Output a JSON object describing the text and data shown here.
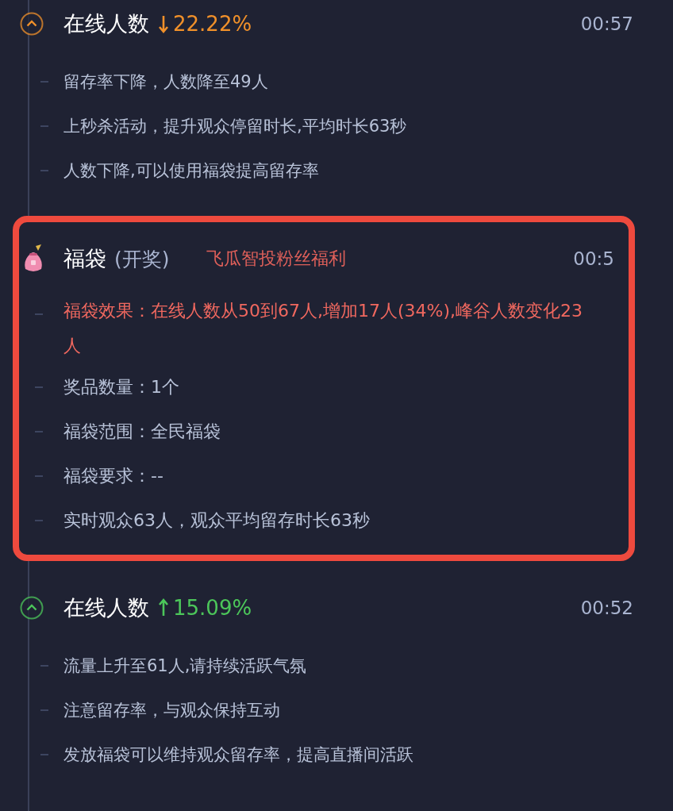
{
  "events": [
    {
      "kind": "online",
      "title": "在线人数",
      "rising": false,
      "change": "22.22%",
      "time": "00:57",
      "highlighted": false,
      "items": [
        {
          "text": "留存率下降，人数降至49人",
          "alert": false
        },
        {
          "text": "上秒杀活动，提升观众停留时长,平均时长63秒",
          "alert": false
        },
        {
          "text": "人数下降,可以使用福袋提高留存率",
          "alert": false
        }
      ]
    },
    {
      "kind": "lucky_bag",
      "title": "福袋",
      "subtitle": "(开奖)",
      "tag": "飞瓜智投粉丝福利",
      "time": "00:5",
      "highlighted": true,
      "items": [
        {
          "text": "福袋效果：在线人数从50到67人,增加17人(34%),峰谷人数变化23人",
          "alert": true
        },
        {
          "text": "奖品数量：1个",
          "alert": false
        },
        {
          "text": "福袋范围：全民福袋",
          "alert": false
        },
        {
          "text": "福袋要求：--",
          "alert": false
        },
        {
          "text": "实时观众63人，观众平均留存时长63秒",
          "alert": false
        }
      ]
    },
    {
      "kind": "online",
      "title": "在线人数",
      "rising": true,
      "change": "15.09%",
      "time": "00:52",
      "highlighted": false,
      "items": [
        {
          "text": "流量上升至61人,请持续活跃气氛",
          "alert": false
        },
        {
          "text": "注意留存率，与观众保持互动",
          "alert": false
        },
        {
          "text": "发放福袋可以维持观众留存率，提高直播间活跃",
          "alert": false
        }
      ]
    }
  ]
}
